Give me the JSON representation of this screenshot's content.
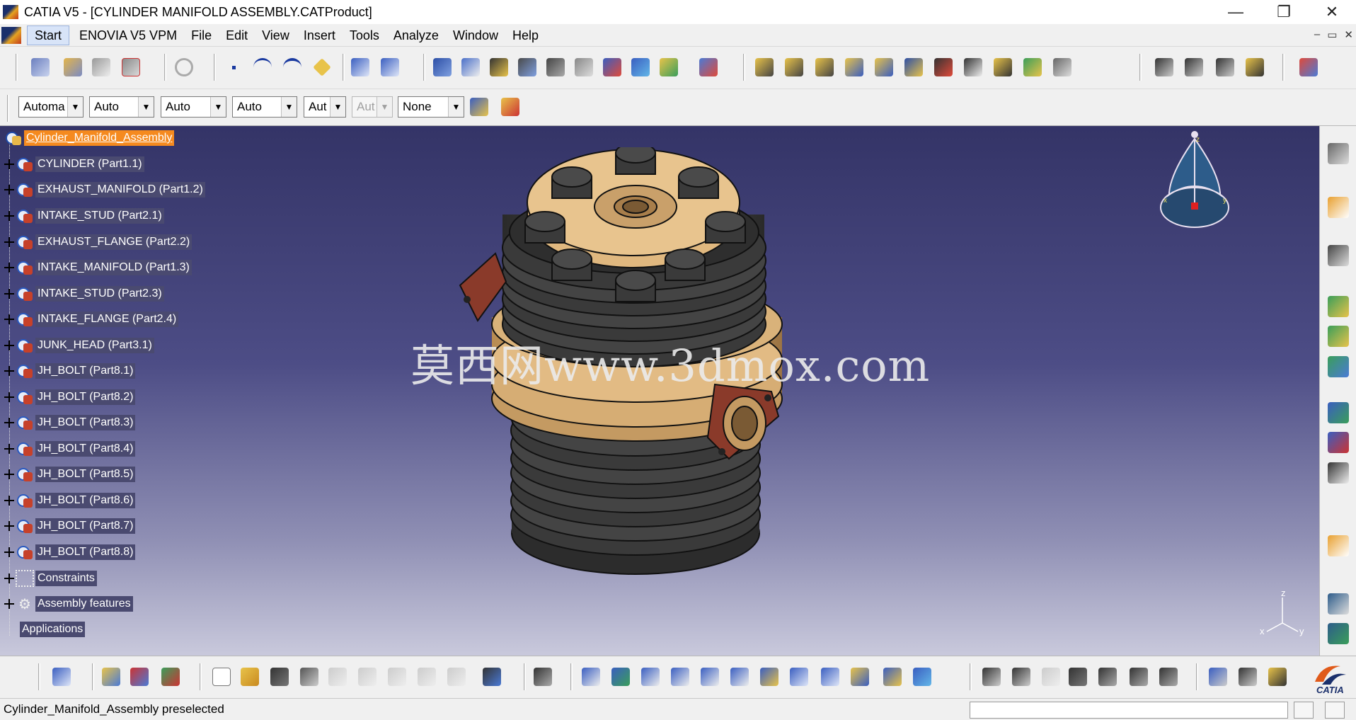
{
  "window": {
    "title": "CATIA V5 - [CYLINDER MANIFOLD ASSEMBLY.CATProduct]",
    "minimize_glyph": "—",
    "restore_glyph": "❐",
    "close_glyph": "✕"
  },
  "menubar": {
    "items": [
      "Start",
      "ENOVIA V5 VPM",
      "File",
      "Edit",
      "View",
      "Insert",
      "Tools",
      "Analyze",
      "Window",
      "Help"
    ],
    "mdi_minimize": "–",
    "mdi_restore": "▭",
    "mdi_close": "✕"
  },
  "properties_toolbar": {
    "combos": [
      {
        "value": "Automa",
        "disabled": false
      },
      {
        "value": "Auto",
        "disabled": false
      },
      {
        "value": "Auto",
        "disabled": false
      },
      {
        "value": "Auto",
        "disabled": false
      },
      {
        "value": "Aut",
        "disabled": false
      },
      {
        "value": "Aut",
        "disabled": true
      },
      {
        "value": "None",
        "disabled": false
      }
    ],
    "dropdown_glyph": "▼"
  },
  "tree": {
    "root": "Cylinder_Manifold_Assembly",
    "parts": [
      "CYLINDER (Part1.1)",
      "EXHAUST_MANIFOLD (Part1.2)",
      "INTAKE_STUD (Part2.1)",
      "EXHAUST_FLANGE (Part2.2)",
      "INTAKE_MANIFOLD (Part1.3)",
      "INTAKE_STUD (Part2.3)",
      "INTAKE_FLANGE (Part2.4)",
      "JUNK_HEAD (Part3.1)",
      "JH_BOLT (Part8.1)",
      "JH_BOLT (Part8.2)",
      "JH_BOLT (Part8.3)",
      "JH_BOLT (Part8.4)",
      "JH_BOLT (Part8.5)",
      "JH_BOLT (Part8.6)",
      "JH_BOLT (Part8.7)",
      "JH_BOLT (Part8.8)"
    ],
    "constraints": "Constraints",
    "assembly_features": "Assembly features",
    "applications": "Applications"
  },
  "viewport": {
    "watermark": "莫西网www.3dmox.com",
    "compass_labels": {
      "z": "z",
      "x": "x",
      "y": "y"
    },
    "triad_labels": {
      "z": "z",
      "x": "x",
      "y": "y"
    },
    "background_top": "#343467",
    "background_bottom": "#c9c9dc",
    "part_colors": {
      "fins": "#3c3c3c",
      "brass": "#d9b27a",
      "flange": "#8a3a2a",
      "bolt": "#404040"
    }
  },
  "statusbar": {
    "message": "Cylinder_Manifold_Assembly preselected"
  },
  "brand": {
    "logo_text": "CATIA"
  }
}
